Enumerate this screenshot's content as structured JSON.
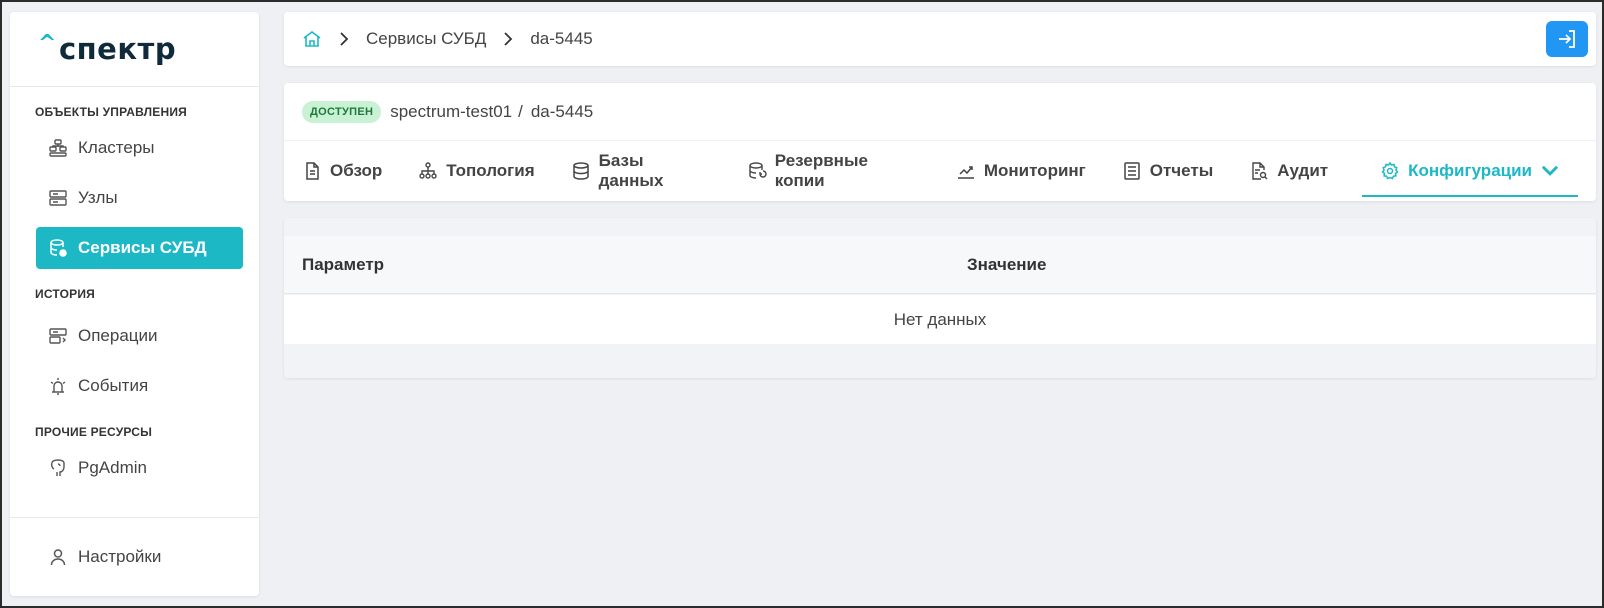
{
  "logo": {
    "caret": "^",
    "text": "спектр"
  },
  "sidebar": {
    "sections": [
      {
        "title": "ОБЪЕКТЫ УПРАВЛЕНИЯ",
        "items": [
          {
            "label": "Кластеры",
            "icon": "cluster-icon"
          },
          {
            "label": "Узлы",
            "icon": "server-icon"
          },
          {
            "label": "Сервисы СУБД",
            "icon": "database-service-icon",
            "active": true
          }
        ]
      },
      {
        "title": "ИСТОРИЯ",
        "items": [
          {
            "label": "Операции",
            "icon": "operations-icon"
          },
          {
            "label": "События",
            "icon": "alarm-icon"
          }
        ]
      },
      {
        "title": "ПРОЧИЕ РЕСУРСЫ",
        "items": [
          {
            "label": "PgAdmin",
            "icon": "postgres-elephant-icon"
          }
        ]
      }
    ],
    "settings_label": "Настройки"
  },
  "breadcrumb": {
    "items": [
      "Сервисы СУБД",
      "da-5445"
    ]
  },
  "service": {
    "status": "ДОСТУПЕН",
    "host": "spectrum-test01",
    "separator": "/",
    "name": "da-5445"
  },
  "tabs": [
    {
      "label": "Обзор",
      "icon": "document-icon"
    },
    {
      "label": "Топология",
      "icon": "topology-icon"
    },
    {
      "label": "Базы данных",
      "icon": "database-icon"
    },
    {
      "label": "Резервные копии",
      "icon": "backup-icon"
    },
    {
      "label": "Мониторинг",
      "icon": "chart-icon"
    },
    {
      "label": "Отчеты",
      "icon": "report-icon"
    },
    {
      "label": "Аудит",
      "icon": "audit-icon"
    },
    {
      "label": "Конфигурации",
      "icon": "gear-icon",
      "active": true
    }
  ],
  "table": {
    "columns": [
      "Параметр",
      "Значение"
    ],
    "empty_text": "Нет данных"
  },
  "colors": {
    "accent": "#1cb8c6",
    "button": "#2196f3",
    "status_bg": "#c9f1d3"
  }
}
